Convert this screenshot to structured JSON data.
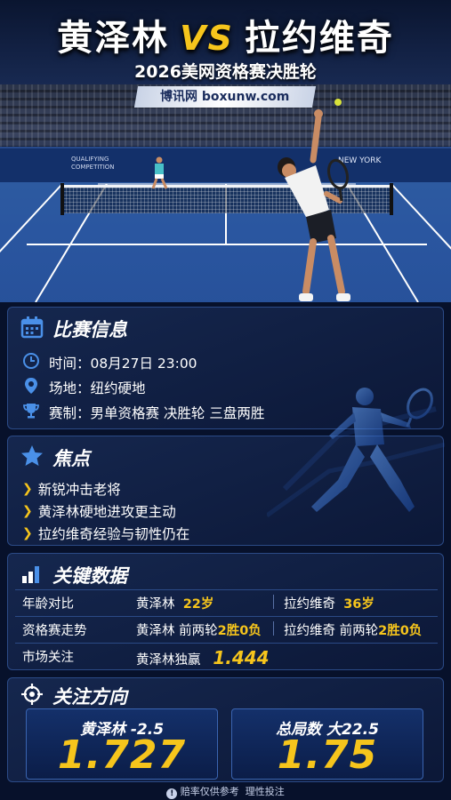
{
  "header": {
    "player_a": "黄泽林",
    "vs": "VS",
    "player_b": "拉约维奇",
    "subtitle": "2026美网资格赛决胜轮",
    "site": "博讯网 boxunw.com"
  },
  "hero": {
    "wall_left": "QUALIFYING\nCOMPETITION",
    "wall_right": "NEW YORK"
  },
  "info": {
    "title": "比赛信息",
    "time": "时间：08月27日 23:00",
    "venue": "场地：纽约硬地",
    "event": "赛制：男单资格赛 决胜轮 三盘两胜"
  },
  "focus": {
    "title": "焦点",
    "points": [
      "新锐冲击老将",
      "黄泽林硬地进攻更主动",
      "拉约维奇经验与韧性仍在"
    ]
  },
  "stats": {
    "title": "关键数据",
    "age": {
      "label": "年龄对比",
      "a_name": "黄泽林",
      "a_val": "22岁",
      "b_name": "拉约维奇",
      "b_val": "36岁"
    },
    "form": {
      "label": "资格赛走势",
      "a_text": "黄泽林 前两轮",
      "a_val": "2胜0负",
      "b_text": "拉约维奇 前两轮",
      "b_val": "2胜0负"
    },
    "market": {
      "label": "市场关注",
      "text": "黄泽林独赢",
      "val": "1.444"
    }
  },
  "direction": {
    "title": "关注方向",
    "left_title": "黄泽林 -2.5",
    "left_value": "1.727",
    "right_title": "总局数 大22.5",
    "right_value": "1.75"
  },
  "footer": {
    "text": "赔率仅供参考  理性投注"
  },
  "colors": {
    "accent": "#f6c51c",
    "background": "#07112b",
    "panel_border": "#2b4a86",
    "icon_blue": "#4a90e8"
  }
}
